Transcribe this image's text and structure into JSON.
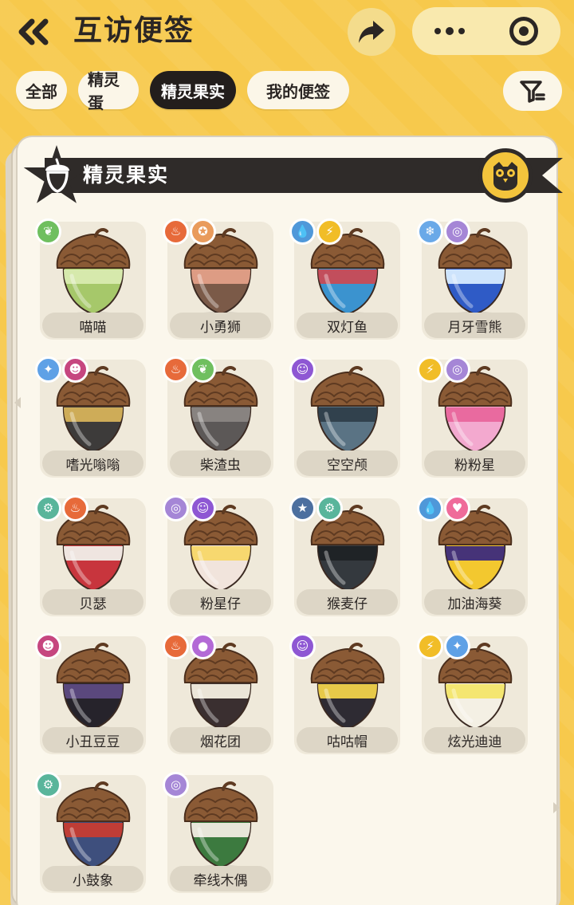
{
  "header": {
    "title": "互访便签",
    "back_icon": "double-chevron-left-icon",
    "share_icon": "share-arrow-icon",
    "more_icon": "more-dots-icon",
    "close_icon": "target-close-icon"
  },
  "tabs": [
    {
      "label": "全部",
      "active": false
    },
    {
      "label": "精灵蛋",
      "active": false
    },
    {
      "label": "精灵果实",
      "active": true
    },
    {
      "label": "我的便签",
      "active": false
    }
  ],
  "filter_icon": "filter-funnel-icon",
  "section": {
    "title": "精灵果实",
    "icon": "acorn-icon",
    "badge_icon": "owl-icon"
  },
  "colors": {
    "background": "#f7c94c",
    "panel": "#fbf7ec",
    "dark": "#2b2624"
  },
  "items": [
    {
      "name": "喵喵",
      "types": [
        "grass"
      ],
      "body": "#a6c86a",
      "band": "#d8ebb0"
    },
    {
      "name": "小勇狮",
      "types": [
        "fire",
        "normal"
      ],
      "body": "#7b5a48",
      "band": "#e3a088"
    },
    {
      "name": "双灯鱼",
      "types": [
        "water",
        "electric"
      ],
      "body": "#3b93cf",
      "band": "#c94a55"
    },
    {
      "name": "月牙雪熊",
      "types": [
        "ice",
        "dragon"
      ],
      "body": "#2f5bc6",
      "band": "#d7ecff"
    },
    {
      "name": "嗜光嗡嗡",
      "types": [
        "light",
        "demon"
      ],
      "body": "#3d3b3a",
      "band": "#d6b25a"
    },
    {
      "name": "柴渣虫",
      "types": [
        "fire",
        "grass"
      ],
      "body": "#5c5857",
      "band": "#8a8683"
    },
    {
      "name": "空空颅",
      "types": [
        "ghost"
      ],
      "body": "#5a7384",
      "band": "#2f3e4a"
    },
    {
      "name": "粉粉星",
      "types": [
        "electric",
        "dragon"
      ],
      "body": "#f3a9cf",
      "band": "#e8669c"
    },
    {
      "name": "贝瑟",
      "types": [
        "mech",
        "fire"
      ],
      "body": "#c8353d",
      "band": "#f1efe9"
    },
    {
      "name": "粉星仔",
      "types": [
        "dragon",
        "ghost"
      ],
      "body": "#f1e4dc",
      "band": "#f7d768"
    },
    {
      "name": "猴麦仔",
      "types": [
        "star",
        "mech"
      ],
      "body": "#34393e",
      "band": "#1f2225"
    },
    {
      "name": "加油海葵",
      "types": [
        "water",
        "fairy"
      ],
      "body": "#f3c82f",
      "band": "#3c2b7c"
    },
    {
      "name": "小丑豆豆",
      "types": [
        "demon"
      ],
      "body": "#26232b",
      "band": "#5d4b82"
    },
    {
      "name": "烟花团",
      "types": [
        "fire",
        "spirit"
      ],
      "body": "#3a2f30",
      "band": "#f4efe2"
    },
    {
      "name": "咕咕帽",
      "types": [
        "ghost"
      ],
      "body": "#2e2b33",
      "band": "#f1d24b"
    },
    {
      "name": "炫光迪迪",
      "types": [
        "electric",
        "light"
      ],
      "body": "#f4f0e4",
      "band": "#f3e56a"
    },
    {
      "name": "小鼓象",
      "types": [
        "mech"
      ],
      "body": "#3e4f7d",
      "band": "#c63c33"
    },
    {
      "name": "牵线木偶",
      "types": [
        "dragon"
      ],
      "body": "#3c7a3f",
      "band": "#f1ece2"
    }
  ],
  "type_styles": {
    "grass": {
      "color": "#6fbf5f",
      "glyph": "❦"
    },
    "fire": {
      "color": "#e76a3a",
      "glyph": "♨"
    },
    "normal": {
      "color": "#e99b5c",
      "glyph": "✪"
    },
    "water": {
      "color": "#4f98d9",
      "glyph": "💧"
    },
    "electric": {
      "color": "#f1bd27",
      "glyph": "⚡"
    },
    "ice": {
      "color": "#6aa9e8",
      "glyph": "❄"
    },
    "dragon": {
      "color": "#a586d6",
      "glyph": "◎"
    },
    "light": {
      "color": "#5fa1e6",
      "glyph": "✦"
    },
    "demon": {
      "color": "#c6467f",
      "glyph": "☻"
    },
    "ghost": {
      "color": "#8e57d3",
      "glyph": "☺"
    },
    "mech": {
      "color": "#59b59b",
      "glyph": "⚙"
    },
    "star": {
      "color": "#4c6f9f",
      "glyph": "★"
    },
    "fairy": {
      "color": "#ef6b9a",
      "glyph": "♥"
    },
    "spirit": {
      "color": "#b36ad6",
      "glyph": "●"
    }
  }
}
